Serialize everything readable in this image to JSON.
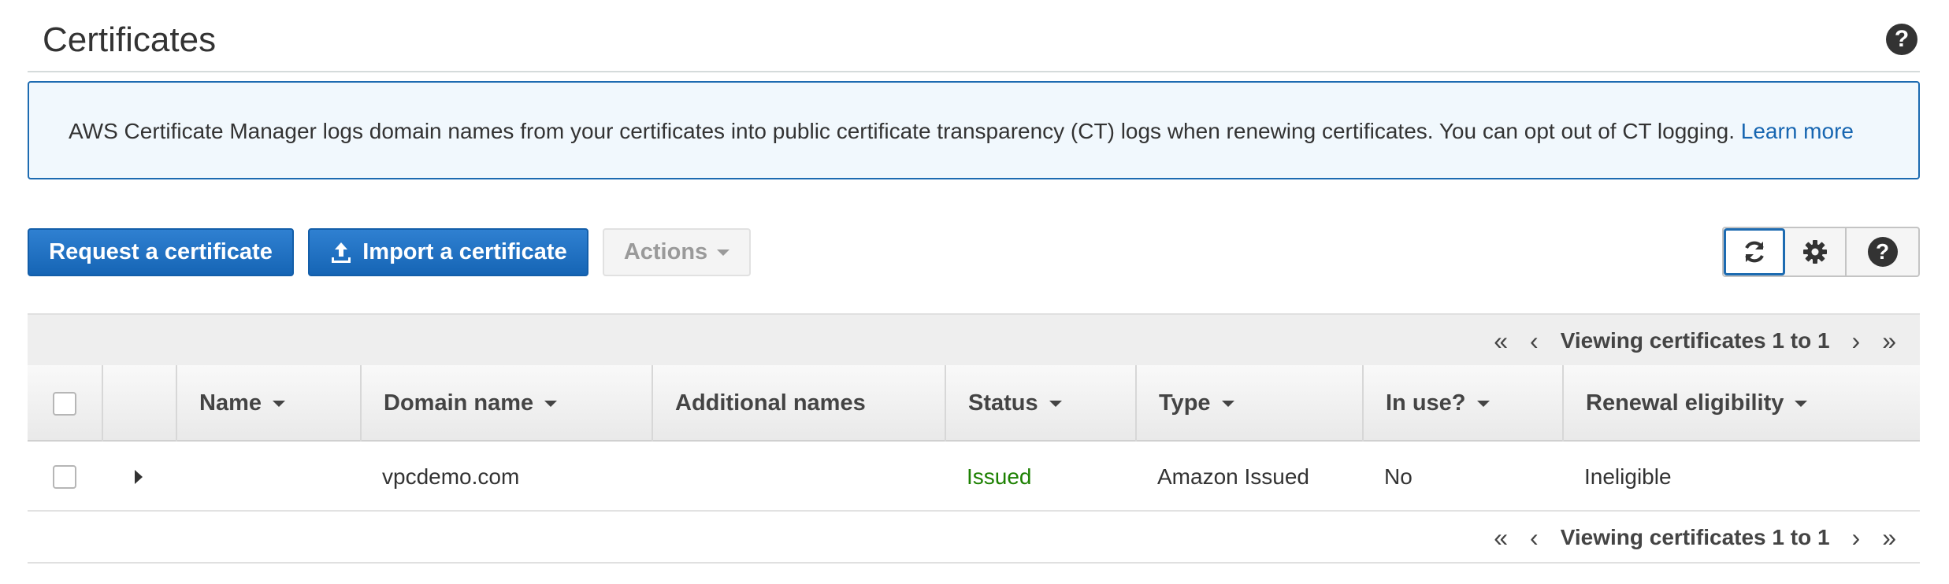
{
  "page": {
    "title": "Certificates"
  },
  "banner": {
    "text": "AWS Certificate Manager logs domain names from your certificates into public certificate transparency (CT) logs when renewing certificates. You can opt out of CT logging. ",
    "link": "Learn more"
  },
  "toolbar": {
    "request_label": "Request a certificate",
    "import_label": "Import a certificate",
    "actions_label": "Actions"
  },
  "icons": {
    "help": "?",
    "refresh": "refresh-icon",
    "settings": "gear-icon",
    "first_page": "«",
    "prev_page": "‹",
    "next_page": "›",
    "last_page": "»"
  },
  "pagination": {
    "label": "Viewing certificates 1 to 1"
  },
  "table": {
    "columns": [
      "Name",
      "Domain name",
      "Additional names",
      "Status",
      "Type",
      "In use?",
      "Renewal eligibility"
    ],
    "rows": [
      {
        "name": "",
        "domain": "vpcdemo.com",
        "additional": "",
        "status": "Issued",
        "type": "Amazon Issued",
        "in_use": "No",
        "renewal": "Ineligible"
      }
    ]
  },
  "colors": {
    "primary": "#1665b5",
    "link": "#1766b1",
    "issued": "#1d8102",
    "banner_bg": "#f1f8fd"
  }
}
